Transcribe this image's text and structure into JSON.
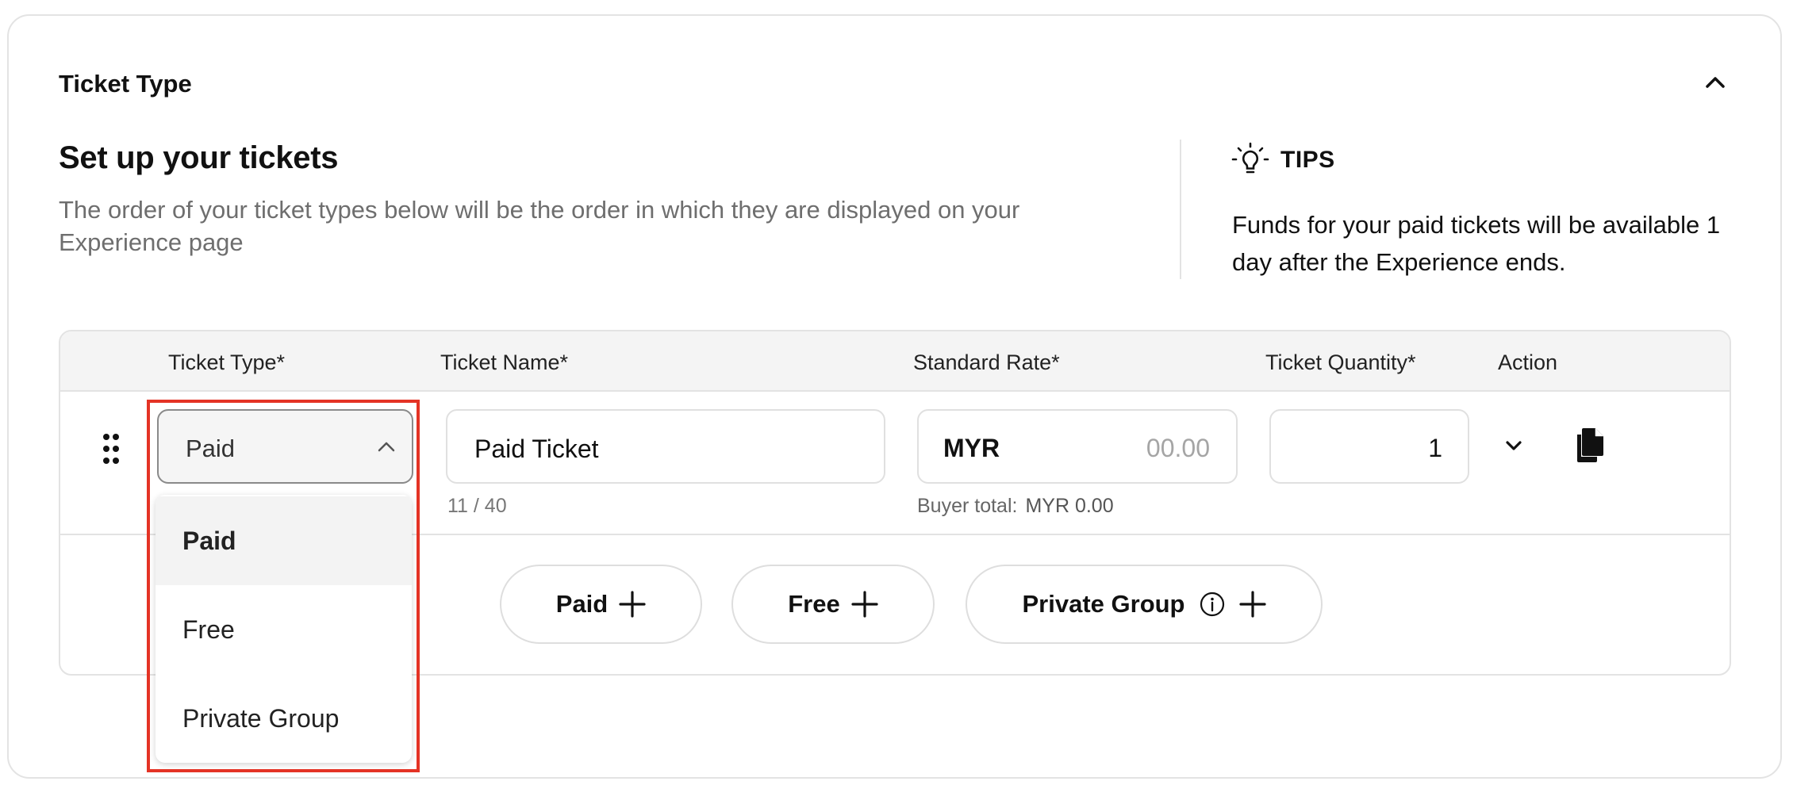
{
  "section": {
    "title": "Ticket Type"
  },
  "intro": {
    "heading": "Set up your tickets",
    "description": "The order of your ticket types below will be the order in which they are displayed on your Experience page"
  },
  "tips": {
    "title": "TIPS",
    "text": "Funds for your paid tickets will be available 1 day after the Experience ends."
  },
  "table": {
    "columns": [
      "Ticket Type*",
      "Ticket Name*",
      "Standard Rate*",
      "Ticket Quantity*",
      "Action"
    ],
    "row": {
      "ticket_type": "Paid",
      "ticket_name": "Paid Ticket",
      "name_counter": "11 / 40",
      "currency": "MYR",
      "rate_placeholder": "00.00",
      "buyer_total_label": "Buyer total:",
      "buyer_total_value": "MYR 0.00",
      "quantity": "1"
    }
  },
  "add_buttons": [
    "Paid",
    "Free",
    "Private Group"
  ],
  "dropdown": {
    "options": [
      "Paid",
      "Free",
      "Private Group"
    ],
    "selected_index": 0
  },
  "colors": {
    "highlight": "#e43325",
    "border": "#e3e3e3",
    "header_bg": "#f4f4f4"
  },
  "icons": [
    "chevron-up-icon",
    "lightbulb-icon",
    "drag-handle-icon",
    "chevron-down-icon",
    "copy-icon",
    "plus-icon",
    "info-icon"
  ]
}
